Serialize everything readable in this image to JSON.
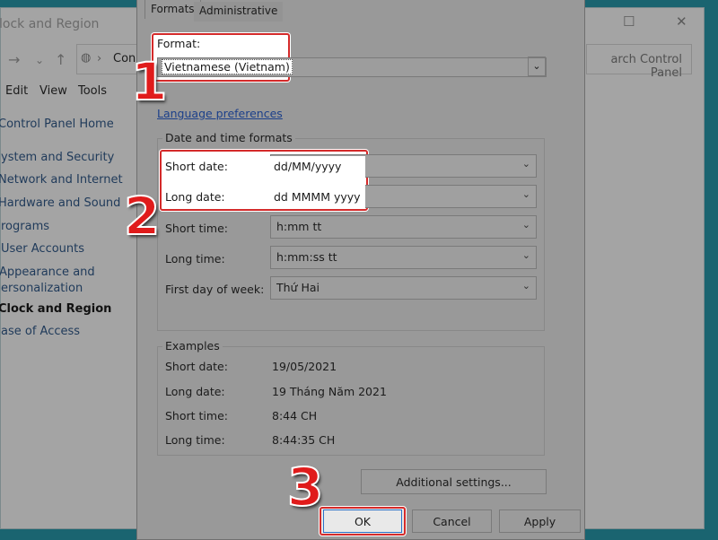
{
  "background_window": {
    "title": "lock and Region",
    "address": "Con",
    "search_placeholder": "arch Control Panel",
    "menu": [
      "Edit",
      "View",
      "Tools"
    ],
    "sidebar": [
      "Control Panel Home",
      "ystem and Security",
      "Network and Internet",
      "Hardware and Sound",
      "rograms",
      "User Accounts",
      "Appearance and",
      "ersonalization",
      "Clock and Region",
      "ase of Access"
    ]
  },
  "dialog": {
    "tabs": [
      "Formats",
      "Administrative"
    ],
    "format_label": "Format:",
    "format_value": "Vietnamese (Vietnam)",
    "language_link": "Language preferences",
    "date_time_group": "Date and time formats",
    "fields": [
      {
        "label": "Short date:",
        "value": "dd/MM/yyyy"
      },
      {
        "label": "Long date:",
        "value": "dd MMMM yyyy"
      },
      {
        "label": "Short time:",
        "value": "h:mm tt"
      },
      {
        "label": "Long time:",
        "value": "h:mm:ss tt"
      },
      {
        "label": "First day of week:",
        "value": "Thứ Hai"
      }
    ],
    "examples_group": "Examples",
    "examples": [
      {
        "label": "Short date:",
        "value": "19/05/2021"
      },
      {
        "label": "Long date:",
        "value": "19 Tháng Năm 2021"
      },
      {
        "label": "Short time:",
        "value": "8:44 CH"
      },
      {
        "label": "Long time:",
        "value": "8:44:35 CH"
      }
    ],
    "additional_settings": "Additional settings...",
    "ok": "OK",
    "cancel": "Cancel",
    "apply": "Apply"
  },
  "steps": [
    "1",
    "2",
    "3"
  ],
  "colors": {
    "highlight": "#d42a2a",
    "step": "#e01b1b",
    "desktop": "#1a6470"
  }
}
